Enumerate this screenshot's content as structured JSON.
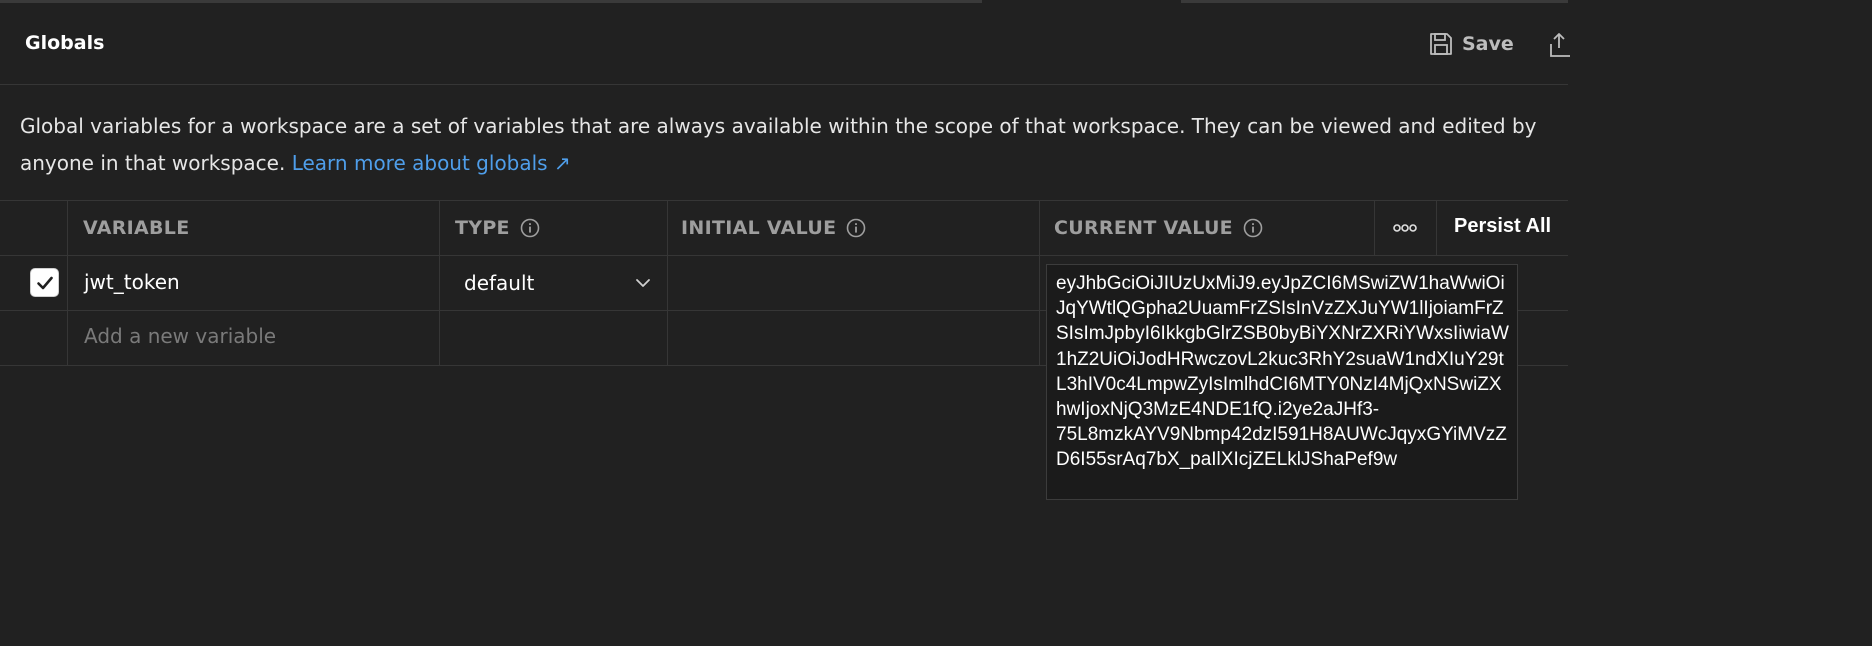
{
  "header": {
    "title": "Globals",
    "save_label": "Save"
  },
  "description": {
    "text": "Global variables for a workspace are a set of variables that are always available within the scope of that workspace. They can be viewed and edited by anyone in that workspace.",
    "link_text": "Learn more about globals ↗"
  },
  "table": {
    "columns": {
      "variable": "VARIABLE",
      "type": "TYPE",
      "initial_value": "INITIAL VALUE",
      "current_value": "CURRENT VALUE",
      "persist_all": "Persist All"
    },
    "rows": [
      {
        "enabled": true,
        "variable": "jwt_token",
        "type": "default",
        "initial_value": "",
        "current_value": "eyJhbGciOiJIUzUxMiJ9.eyJpZCI6MSwiZW1haWwiOiJqYWtlQGpha2UuamFrZSIsInVzZXJuYW1lIjoiamFrZSIsImJpbyI6IkkgbGlrZSB0byBiYXNrZXRiYWxsIiwiaW1hZ2UiOiJodHRwczovL2kuc3RhY2suaW1ndXIuY29tL3hIV0c4LmpwZyIsImlhdCI6MTY0NzI4MjQxNSwiZXhwIjoxNjQ3MzE4NDE1fQ.i2ye2aJHf3-\n75L8mzkAYV9Nbmp42dzI591H8AUWcJqyxGYiMVzZD6I55srAq7bX_paIlXIcjZELklJShaPef9w"
      }
    ],
    "add_placeholder": "Add a new variable"
  },
  "icons": {
    "save": "floppy-disk-icon",
    "share": "share-upload-icon",
    "info": "info-icon",
    "more": "more-horizontal-icon",
    "chevron": "chevron-down-icon",
    "check": "checkmark-icon"
  },
  "colors": {
    "background": "#212121",
    "link": "#4f9eea",
    "border": "#363636"
  }
}
